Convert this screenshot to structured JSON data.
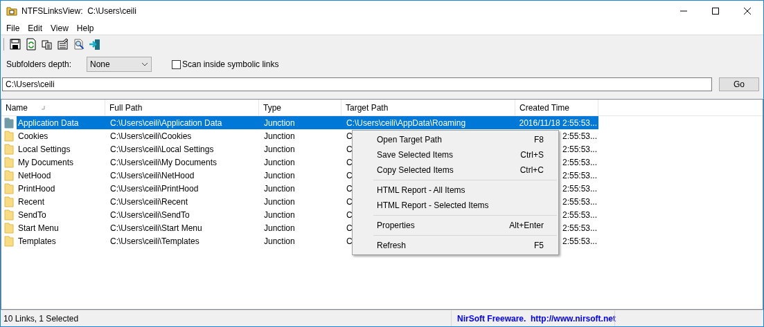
{
  "window": {
    "title": "NTFSLinksView:  C:\\Users\\ceili"
  },
  "menu_bar": [
    "File",
    "Edit",
    "View",
    "Help"
  ],
  "options": {
    "depth_label": "Subfolders depth:",
    "depth_value": "None",
    "scan_label": "Scan inside symbolic links",
    "scan_checked": false
  },
  "path_field": {
    "value": "C:\\Users\\ceili"
  },
  "go_button": "Go",
  "table": {
    "columns": [
      "Name",
      "Full Path",
      "Type",
      "Target Path",
      "Created Time"
    ],
    "rows": [
      {
        "name": "Application Data",
        "full_path": "C:\\Users\\ceili\\Application Data",
        "type": "Junction",
        "target": "C:\\Users\\ceili\\AppData\\Roaming",
        "created": "2016/11/18 2:55:53...",
        "selected": true
      },
      {
        "name": "Cookies",
        "full_path": "C:\\Users\\ceili\\Cookies",
        "type": "Junction",
        "target": "C",
        "created": "2:55:53...",
        "selected": false
      },
      {
        "name": "Local Settings",
        "full_path": "C:\\Users\\ceili\\Local Settings",
        "type": "Junction",
        "target": "C",
        "created": "2:55:53...",
        "selected": false
      },
      {
        "name": "My Documents",
        "full_path": "C:\\Users\\ceili\\My Documents",
        "type": "Junction",
        "target": "C",
        "created": "2:55:53...",
        "selected": false
      },
      {
        "name": "NetHood",
        "full_path": "C:\\Users\\ceili\\NetHood",
        "type": "Junction",
        "target": "C",
        "created": "2:55:53...",
        "selected": false
      },
      {
        "name": "PrintHood",
        "full_path": "C:\\Users\\ceili\\PrintHood",
        "type": "Junction",
        "target": "C",
        "created": "2:55:53...",
        "selected": false
      },
      {
        "name": "Recent",
        "full_path": "C:\\Users\\ceili\\Recent",
        "type": "Junction",
        "target": "C",
        "created": "2:55:53...",
        "selected": false
      },
      {
        "name": "SendTo",
        "full_path": "C:\\Users\\ceili\\SendTo",
        "type": "Junction",
        "target": "C",
        "created": "2:55:53...",
        "selected": false
      },
      {
        "name": "Start Menu",
        "full_path": "C:\\Users\\ceili\\Start Menu",
        "type": "Junction",
        "target": "C",
        "created": "2:55:53...",
        "selected": false
      },
      {
        "name": "Templates",
        "full_path": "C:\\Users\\ceili\\Templates",
        "type": "Junction",
        "target": "C",
        "created": "2:55:53...",
        "selected": false
      }
    ]
  },
  "context_menu": [
    {
      "kind": "item",
      "label": "Open Target Path",
      "shortcut": "F8"
    },
    {
      "kind": "item",
      "label": "Save Selected Items",
      "shortcut": "Ctrl+S"
    },
    {
      "kind": "item",
      "label": "Copy Selected Items",
      "shortcut": "Ctrl+C"
    },
    {
      "kind": "separator"
    },
    {
      "kind": "item",
      "label": "HTML Report - All Items"
    },
    {
      "kind": "item",
      "label": "HTML Report - Selected Items"
    },
    {
      "kind": "separator"
    },
    {
      "kind": "item",
      "label": "Properties",
      "shortcut": "Alt+Enter"
    },
    {
      "kind": "separator"
    },
    {
      "kind": "item",
      "label": "Refresh",
      "shortcut": "F5"
    }
  ],
  "status_bar": {
    "count": "10 Links, 1 Selected",
    "link": "NirSoft Freeware.  http://www.nirsoft.net"
  }
}
